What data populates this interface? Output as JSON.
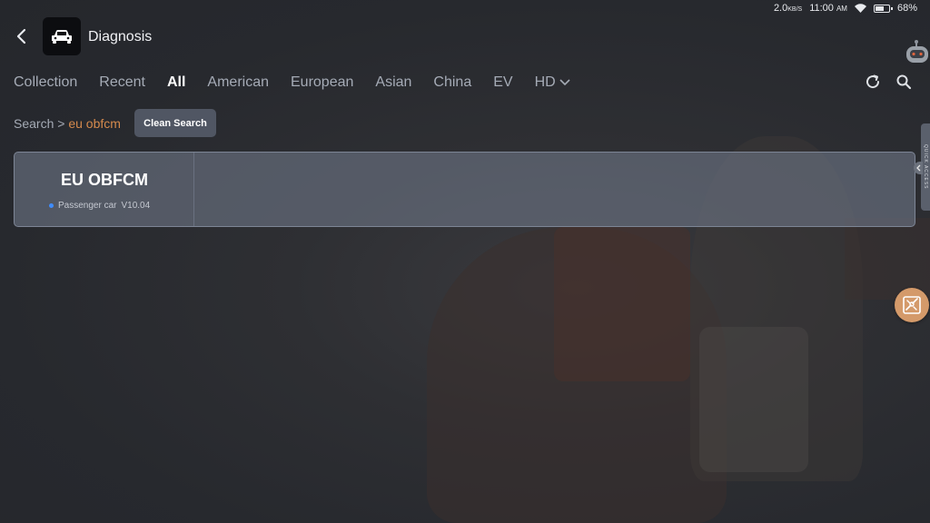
{
  "status_bar": {
    "net_speed": "2.0",
    "net_unit": "KB/S",
    "time": "11:00",
    "ampm": "AM",
    "battery": "68%",
    "battery_level": 0.68
  },
  "header": {
    "title": "Diagnosis",
    "app_icon": "car-icon"
  },
  "tabs": [
    {
      "label": "Collection",
      "active": false
    },
    {
      "label": "Recent",
      "active": false
    },
    {
      "label": "All",
      "active": true
    },
    {
      "label": "American",
      "active": false
    },
    {
      "label": "European",
      "active": false
    },
    {
      "label": "Asian",
      "active": false
    },
    {
      "label": "China",
      "active": false
    },
    {
      "label": "EV",
      "active": false
    },
    {
      "label": "HD",
      "active": false
    }
  ],
  "toolbar": {
    "refresh_icon": "refresh-icon",
    "search_icon": "search-icon"
  },
  "search": {
    "prefix": "Search",
    "separator": ">",
    "term": "eu obfcm",
    "clean_label": "Clean Search"
  },
  "results": [
    {
      "name": "EU OBFCM",
      "category": "Passenger car",
      "version": "V10.04"
    }
  ],
  "quick_access": {
    "label": "QUICK ACCESS"
  },
  "colors": {
    "accent": "#d58a4d",
    "fab": "#d49a6a",
    "status_dot": "#3f8dff"
  }
}
